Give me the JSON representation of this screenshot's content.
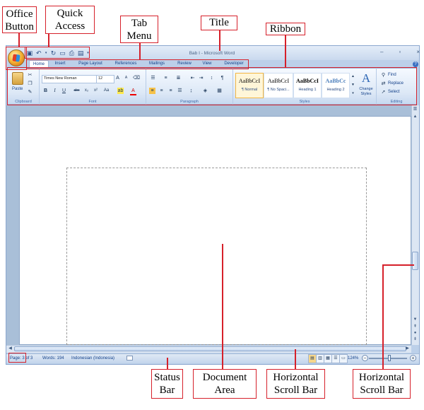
{
  "annotations": {
    "office_button": "Office\nButton",
    "quick_access": "Quick\nAccess",
    "tab_menu": "Tab\nMenu",
    "title": "Title",
    "ribbon": "Ribbon",
    "status_bar": "Status\nBar",
    "document_area": "Document\nArea",
    "horizontal_scroll_bar_1": "Horizontal\nScroll Bar",
    "horizontal_scroll_bar_2": "Horizontal\nScroll Bar"
  },
  "window": {
    "title": "Bab I - Microsoft Word",
    "controls": [
      "–",
      "▫",
      "×"
    ]
  },
  "tabs": [
    "Home",
    "Insert",
    "Page Layout",
    "References",
    "Mailings",
    "Review",
    "View",
    "Developer"
  ],
  "ribbon": {
    "clipboard": {
      "paste": "Paste",
      "label": "Clipboard"
    },
    "font": {
      "name": "Times New Roman",
      "size": "12",
      "label": "Font"
    },
    "paragraph": {
      "label": "Paragraph"
    },
    "styles": {
      "label": "Styles",
      "tiles": [
        {
          "sample": "AaBbCcI",
          "name": "¶ Normal"
        },
        {
          "sample": "AaBbCcI",
          "name": "¶ No Spaci..."
        },
        {
          "sample": "AaBbCcI",
          "name": "Heading 1"
        },
        {
          "sample": "AaBbCc",
          "name": "Heading 2"
        }
      ],
      "change_styles": "Change Styles"
    },
    "editing": {
      "find": "Find",
      "replace": "Replace",
      "select": "Select",
      "label": "Editing"
    }
  },
  "status": {
    "page": "Page: 3 of 3",
    "words": "Words: 194",
    "language": "Indonesian (Indonesia)",
    "zoom": "124%"
  },
  "colors": {
    "annotation_red": "#d6202a",
    "ribbon_blue": "#dce8f6",
    "frame_blue": "#bcd0e9"
  }
}
